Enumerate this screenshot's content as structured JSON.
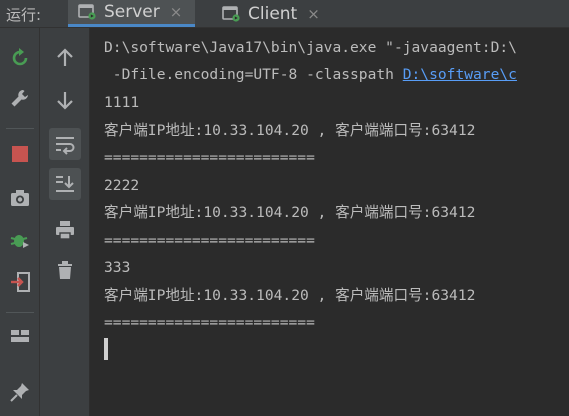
{
  "run_panel": {
    "label": "运行:",
    "tabs": [
      {
        "label": "Server",
        "close": "×"
      },
      {
        "label": "Client",
        "close": "×"
      }
    ]
  },
  "colors": {
    "rerun_green": "#499c54",
    "stop_red": "#c75450",
    "icon_gray": "#afb1b3",
    "link_blue": "#589df6",
    "tab_accent": "#4a88c7"
  },
  "left_toolbar": [
    {
      "name": "rerun-icon"
    },
    {
      "name": "wrench-icon"
    },
    {
      "name": "stop-icon"
    },
    {
      "name": "camera-icon"
    },
    {
      "name": "debug-bug-icon"
    },
    {
      "name": "login-exit-icon"
    },
    {
      "name": "layout-icon"
    },
    {
      "name": "pin-icon"
    }
  ],
  "second_toolbar": [
    {
      "name": "arrow-up-icon"
    },
    {
      "name": "arrow-down-icon"
    },
    {
      "name": "soft-wrap-icon"
    },
    {
      "name": "scroll-to-end-icon"
    },
    {
      "name": "print-icon"
    },
    {
      "name": "trash-icon"
    }
  ],
  "console": {
    "cmd_line_1": "D:\\software\\Java17\\bin\\java.exe \"-javaagent:D:\\",
    "cmd_line_2_prefix": " -Dfile.encoding=UTF-8 -classpath ",
    "cmd_line_2_link": "D:\\software\\c",
    "lines": [
      "1111",
      "客户端IP地址:10.33.104.20 , 客户端端口号:63412",
      "========================",
      "2222",
      "客户端IP地址:10.33.104.20 , 客户端端口号:63412",
      "========================",
      "333",
      "客户端IP地址:10.33.104.20 , 客户端端口号:63412",
      "========================"
    ]
  }
}
